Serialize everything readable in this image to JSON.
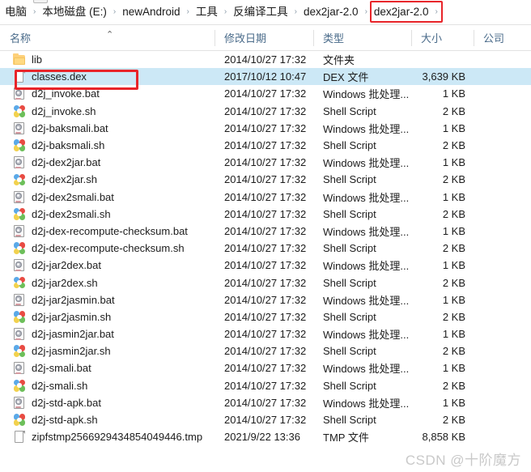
{
  "window": {
    "app": "windows-file-explorer"
  },
  "addressbar": {
    "nav_dropdown_icon": "chevron-down-icon",
    "separator": "›",
    "crumbs": [
      {
        "label": "电脑"
      },
      {
        "label": "本地磁盘 (E:)"
      },
      {
        "label": "newAndroid"
      },
      {
        "label": "工具"
      },
      {
        "label": "反编译工具"
      },
      {
        "label": "dex2jar-2.0"
      },
      {
        "label": "dex2jar-2.0",
        "highlighted": true
      }
    ],
    "highlight_color": "#e8252a"
  },
  "columns": {
    "sort_indicator": "⌃",
    "headers": [
      {
        "key": "name",
        "label": "名称"
      },
      {
        "key": "date",
        "label": "修改日期"
      },
      {
        "key": "type",
        "label": "类型"
      },
      {
        "key": "size",
        "label": "大小"
      },
      {
        "key": "company",
        "label": "公司"
      }
    ],
    "header_color": "#4a6b8a"
  },
  "selection": {
    "highlight_color": "#cce8f6",
    "annotation_color": "#e8252a",
    "selected_index": 1
  },
  "files": [
    {
      "icon": "folder-icon",
      "name": "lib",
      "date": "2014/10/27 17:32",
      "type": "文件夹",
      "size": "",
      "company": ""
    },
    {
      "icon": "page-icon",
      "name": "classes.dex",
      "date": "2017/10/12 10:47",
      "type": "DEX 文件",
      "size": "3,639 KB",
      "company": "",
      "selected": true,
      "annotated": true
    },
    {
      "icon": "bat-file-icon",
      "name": "d2j_invoke.bat",
      "date": "2014/10/27 17:32",
      "type": "Windows 批处理...",
      "size": "1 KB",
      "company": ""
    },
    {
      "icon": "shell-script-icon",
      "name": "d2j_invoke.sh",
      "date": "2014/10/27 17:32",
      "type": "Shell Script",
      "size": "2 KB",
      "company": ""
    },
    {
      "icon": "bat-file-icon",
      "name": "d2j-baksmali.bat",
      "date": "2014/10/27 17:32",
      "type": "Windows 批处理...",
      "size": "1 KB",
      "company": ""
    },
    {
      "icon": "shell-script-icon",
      "name": "d2j-baksmali.sh",
      "date": "2014/10/27 17:32",
      "type": "Shell Script",
      "size": "2 KB",
      "company": ""
    },
    {
      "icon": "bat-file-icon",
      "name": "d2j-dex2jar.bat",
      "date": "2014/10/27 17:32",
      "type": "Windows 批处理...",
      "size": "1 KB",
      "company": ""
    },
    {
      "icon": "shell-script-icon",
      "name": "d2j-dex2jar.sh",
      "date": "2014/10/27 17:32",
      "type": "Shell Script",
      "size": "2 KB",
      "company": ""
    },
    {
      "icon": "bat-file-icon",
      "name": "d2j-dex2smali.bat",
      "date": "2014/10/27 17:32",
      "type": "Windows 批处理...",
      "size": "1 KB",
      "company": ""
    },
    {
      "icon": "shell-script-icon",
      "name": "d2j-dex2smali.sh",
      "date": "2014/10/27 17:32",
      "type": "Shell Script",
      "size": "2 KB",
      "company": ""
    },
    {
      "icon": "bat-file-icon",
      "name": "d2j-dex-recompute-checksum.bat",
      "date": "2014/10/27 17:32",
      "type": "Windows 批处理...",
      "size": "1 KB",
      "company": ""
    },
    {
      "icon": "shell-script-icon",
      "name": "d2j-dex-recompute-checksum.sh",
      "date": "2014/10/27 17:32",
      "type": "Shell Script",
      "size": "2 KB",
      "company": ""
    },
    {
      "icon": "bat-file-icon",
      "name": "d2j-jar2dex.bat",
      "date": "2014/10/27 17:32",
      "type": "Windows 批处理...",
      "size": "1 KB",
      "company": ""
    },
    {
      "icon": "shell-script-icon",
      "name": "d2j-jar2dex.sh",
      "date": "2014/10/27 17:32",
      "type": "Shell Script",
      "size": "2 KB",
      "company": ""
    },
    {
      "icon": "bat-file-icon",
      "name": "d2j-jar2jasmin.bat",
      "date": "2014/10/27 17:32",
      "type": "Windows 批处理...",
      "size": "1 KB",
      "company": ""
    },
    {
      "icon": "shell-script-icon",
      "name": "d2j-jar2jasmin.sh",
      "date": "2014/10/27 17:32",
      "type": "Shell Script",
      "size": "2 KB",
      "company": ""
    },
    {
      "icon": "bat-file-icon",
      "name": "d2j-jasmin2jar.bat",
      "date": "2014/10/27 17:32",
      "type": "Windows 批处理...",
      "size": "1 KB",
      "company": ""
    },
    {
      "icon": "shell-script-icon",
      "name": "d2j-jasmin2jar.sh",
      "date": "2014/10/27 17:32",
      "type": "Shell Script",
      "size": "2 KB",
      "company": ""
    },
    {
      "icon": "bat-file-icon",
      "name": "d2j-smali.bat",
      "date": "2014/10/27 17:32",
      "type": "Windows 批处理...",
      "size": "1 KB",
      "company": ""
    },
    {
      "icon": "shell-script-icon",
      "name": "d2j-smali.sh",
      "date": "2014/10/27 17:32",
      "type": "Shell Script",
      "size": "2 KB",
      "company": ""
    },
    {
      "icon": "bat-file-icon",
      "name": "d2j-std-apk.bat",
      "date": "2014/10/27 17:32",
      "type": "Windows 批处理...",
      "size": "1 KB",
      "company": ""
    },
    {
      "icon": "shell-script-icon",
      "name": "d2j-std-apk.sh",
      "date": "2014/10/27 17:32",
      "type": "Shell Script",
      "size": "2 KB",
      "company": ""
    },
    {
      "icon": "page-icon",
      "name": "zipfstmp2566929434854049446.tmp",
      "date": "2021/9/22 13:36",
      "type": "TMP 文件",
      "size": "8,858 KB",
      "company": ""
    }
  ],
  "watermark": {
    "text": "CSDN @十阶魔方"
  }
}
